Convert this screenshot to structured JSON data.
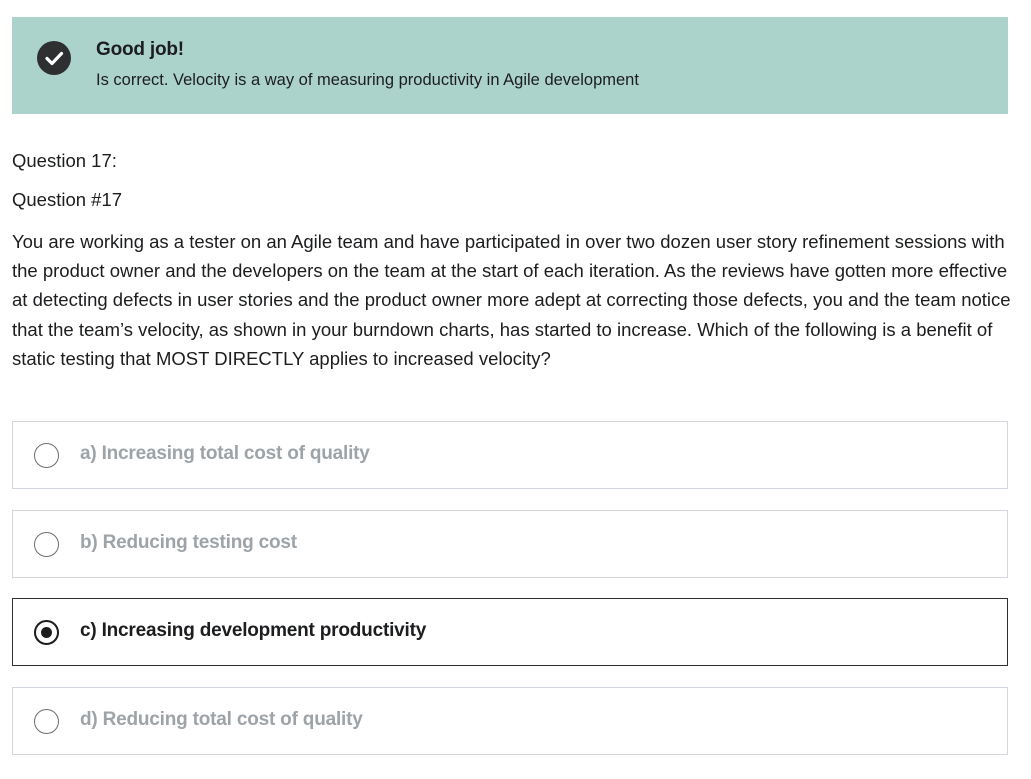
{
  "feedback": {
    "title": "Good job!",
    "message": "Is correct. Velocity is a way of measuring productivity in Agile development",
    "icon": "check-circle-icon",
    "background_color": "#acd2cc"
  },
  "question": {
    "label": "Question 17:",
    "number": "Question #17",
    "text": "You are working as a tester on an Agile team and have participated in over two dozen user story refinement sessions with the product owner and the developers on the team at the start of each iteration. As the reviews have gotten more effective at detecting defects in user stories and the product owner more adept at correcting those defects, you and the team notice that the team’s velocity, as shown in your burndown charts, has started to increase. Which of the following is a benefit of static testing that MOST DIRECTLY applies to increased velocity?"
  },
  "options": [
    {
      "label": "a) Increasing total cost of quality",
      "selected": false
    },
    {
      "label": "b) Reducing testing cost",
      "selected": false
    },
    {
      "label": "c) Increasing development productivity",
      "selected": true
    },
    {
      "label": "d) Reducing total cost of quality",
      "selected": false
    }
  ]
}
